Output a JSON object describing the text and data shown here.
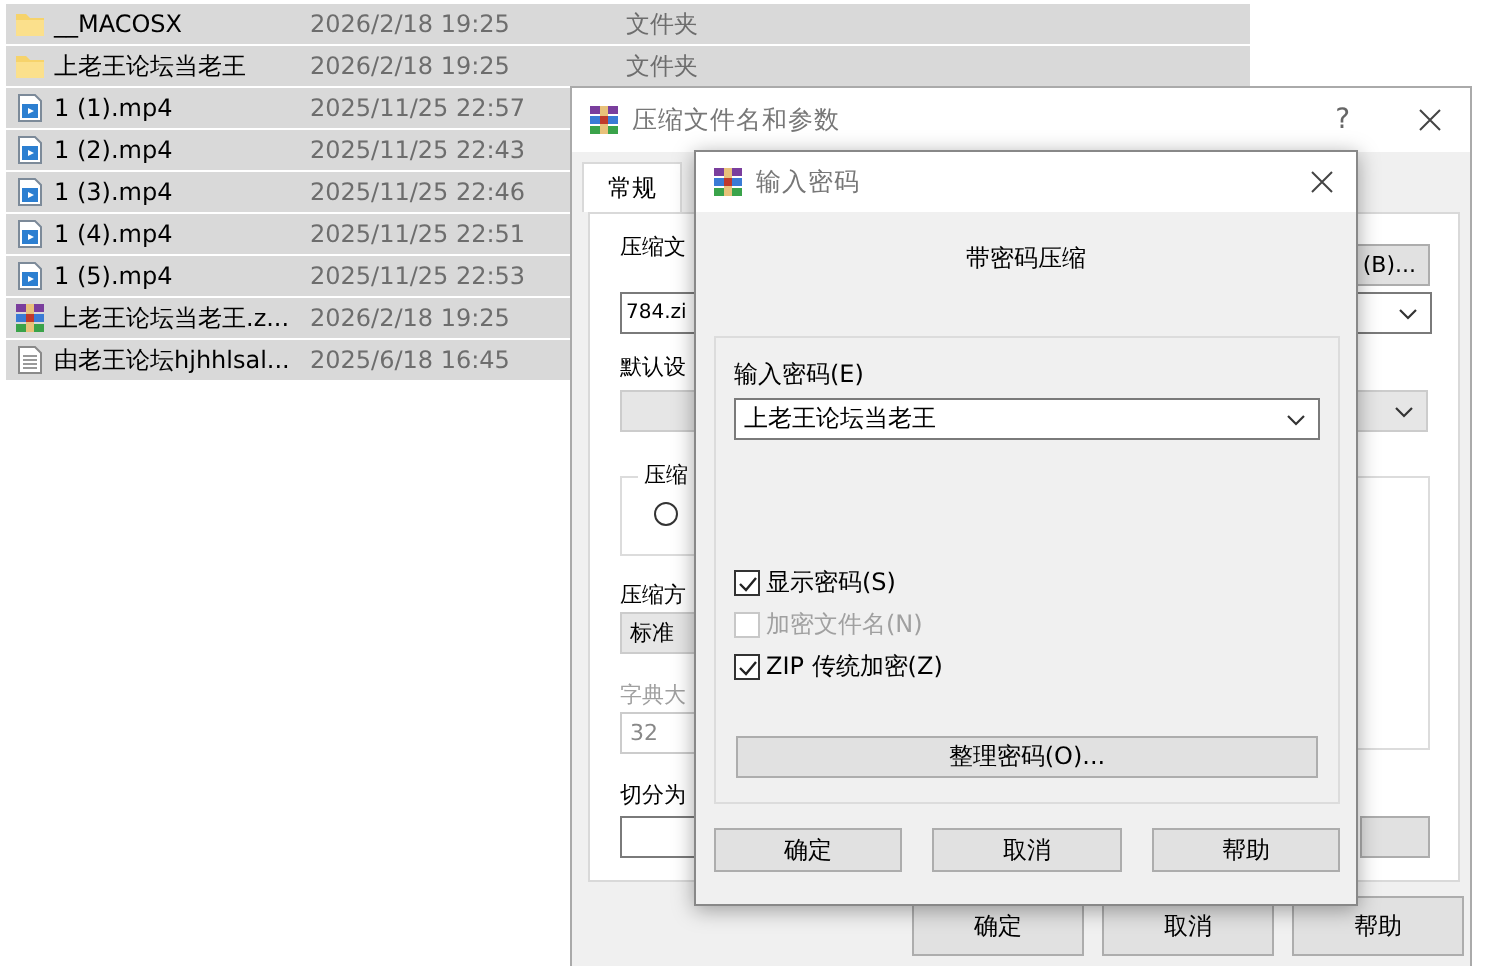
{
  "files": [
    {
      "name": "__MACOSX",
      "modified": "2026/2/18 19:25",
      "type": "文件夹",
      "kind": "folder",
      "selected": true
    },
    {
      "name": "上老王论坛当老王",
      "modified": "2026/2/18 19:25",
      "type": "文件夹",
      "kind": "folder",
      "selected": true
    },
    {
      "name": "1 (1).mp4",
      "modified": "2025/11/25 22:57",
      "kind": "video",
      "selected": true
    },
    {
      "name": "1 (2).mp4",
      "modified": "2025/11/25 22:43",
      "kind": "video",
      "selected": true
    },
    {
      "name": "1 (3).mp4",
      "modified": "2025/11/25 22:46",
      "kind": "video",
      "selected": true
    },
    {
      "name": "1 (4).mp4",
      "modified": "2025/11/25 22:51",
      "kind": "video",
      "selected": true
    },
    {
      "name": "1 (5).mp4",
      "modified": "2025/11/25 22:53",
      "kind": "video",
      "selected": true
    },
    {
      "name": "上老王论坛当老王.z...",
      "modified": "2026/2/18 19:25",
      "kind": "archive",
      "selected": true
    },
    {
      "name": "由老王论坛hjhhlsal...",
      "modified": "2025/6/18 16:45",
      "kind": "text",
      "selected": true
    }
  ],
  "archive_dialog": {
    "title": "压缩文件名和参数",
    "help": "?",
    "tabs": [
      {
        "label": "常规",
        "selected": true
      }
    ],
    "archive_name_label": "压缩文",
    "browse_button": "(B)...",
    "archive_name": "784.zi",
    "profile_label": "默认设",
    "format_group_label": "压缩",
    "format_radio": {
      "selected": false
    },
    "method_label": "压缩方",
    "method": "标准",
    "dictionary": {
      "label": "字典大",
      "value": "32",
      "disabled": true
    },
    "split_label": "切分为",
    "buttons": [
      "确定",
      "取消",
      "帮助"
    ]
  },
  "password_dialog": {
    "title": "输入密码",
    "heading": "带密码压缩",
    "password_label": "输入密码(E)",
    "password": "上老王论坛当老王",
    "options": [
      {
        "label": "显示密码(S)",
        "checked": true,
        "disabled": false
      },
      {
        "label": "加密文件名(N)",
        "checked": false,
        "disabled": true
      },
      {
        "label": "ZIP 传统加密(Z)",
        "checked": true,
        "disabled": false
      }
    ],
    "organize_button": "整理密码(O)...",
    "buttons": [
      "确定",
      "取消",
      "帮助"
    ]
  }
}
